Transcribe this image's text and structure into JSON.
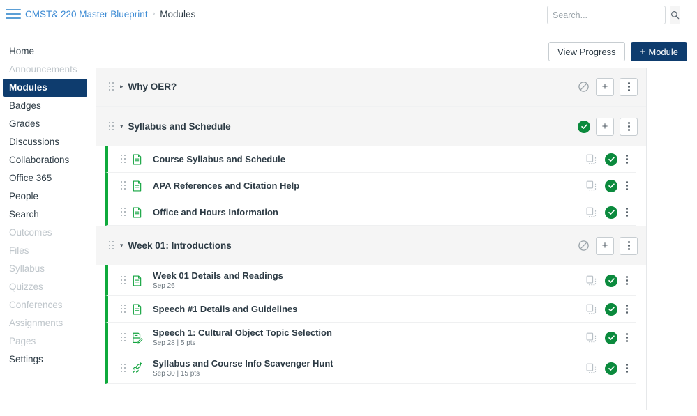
{
  "topbar": {
    "menu_icon": "hamburger-icon",
    "breadcrumb": {
      "course": "CMST& 220 Master Blueprint",
      "separator": "›",
      "current": "Modules"
    },
    "search": {
      "placeholder": "Search...",
      "value": "",
      "button_icon": "search-icon"
    }
  },
  "sidebar": {
    "items": [
      {
        "label": "Home",
        "state": "normal"
      },
      {
        "label": "Announcements",
        "state": "dim"
      },
      {
        "label": "Modules",
        "state": "active"
      },
      {
        "label": "Badges",
        "state": "normal"
      },
      {
        "label": "Grades",
        "state": "normal"
      },
      {
        "label": "Discussions",
        "state": "normal"
      },
      {
        "label": "Collaborations",
        "state": "normal"
      },
      {
        "label": "Office 365",
        "state": "normal"
      },
      {
        "label": "People",
        "state": "normal"
      },
      {
        "label": "Search",
        "state": "normal"
      },
      {
        "label": "Outcomes",
        "state": "dim"
      },
      {
        "label": "Files",
        "state": "dim"
      },
      {
        "label": "Syllabus",
        "state": "dim"
      },
      {
        "label": "Quizzes",
        "state": "dim"
      },
      {
        "label": "Conferences",
        "state": "dim"
      },
      {
        "label": "Assignments",
        "state": "dim"
      },
      {
        "label": "Pages",
        "state": "dim"
      },
      {
        "label": "Settings",
        "state": "normal"
      }
    ]
  },
  "toolbar": {
    "view_progress_label": "View Progress",
    "add_module_plus": "+",
    "add_module_label": "Module"
  },
  "colors": {
    "brand_navy": "#0e3c6e",
    "link_blue": "#3d8bd4",
    "published_green": "#0b8a3d",
    "item_rail_green": "#0faa3c",
    "header_gray": "#f5f5f5"
  },
  "modules": [
    {
      "title": "Why OER?",
      "expanded": false,
      "twisty": "▸",
      "status": "unpublished",
      "status_icon": "circle-slash-icon",
      "add_label": "+",
      "menu_icon": "kebab-menu-icon",
      "items": []
    },
    {
      "title": "Syllabus and Schedule",
      "expanded": true,
      "twisty": "▾",
      "status": "published",
      "status_icon": "check-circle-icon",
      "add_label": "+",
      "menu_icon": "kebab-menu-icon",
      "items": [
        {
          "title": "Course Syllabus and Schedule",
          "subtitle": "",
          "type_icon": "page-icon",
          "status": "published",
          "copy_icon": "duplicate-icon",
          "menu_icon": "kebab-menu-icon"
        },
        {
          "title": "APA References and Citation Help",
          "subtitle": "",
          "type_icon": "page-icon",
          "status": "published",
          "copy_icon": "duplicate-icon",
          "menu_icon": "kebab-menu-icon"
        },
        {
          "title": "Office and Hours Information",
          "subtitle": "",
          "type_icon": "page-icon",
          "status": "published",
          "copy_icon": "duplicate-icon",
          "menu_icon": "kebab-menu-icon"
        }
      ]
    },
    {
      "title": "Week 01: Introductions",
      "expanded": true,
      "twisty": "▾",
      "status": "unpublished",
      "status_icon": "circle-slash-icon",
      "add_label": "+",
      "menu_icon": "kebab-menu-icon",
      "items": [
        {
          "title": "Week 01 Details and Readings",
          "subtitle": "Sep 26",
          "type_icon": "page-icon",
          "status": "published",
          "copy_icon": "duplicate-icon",
          "menu_icon": "kebab-menu-icon"
        },
        {
          "title": "Speech #1 Details and Guidelines",
          "subtitle": "",
          "type_icon": "page-icon",
          "status": "published",
          "copy_icon": "duplicate-icon",
          "menu_icon": "kebab-menu-icon"
        },
        {
          "title": "Speech 1: Cultural Object Topic Selection",
          "subtitle": "Sep 28  |  5 pts",
          "type_icon": "assignment-icon",
          "status": "published",
          "copy_icon": "duplicate-icon",
          "menu_icon": "kebab-menu-icon"
        },
        {
          "title": "Syllabus and Course Info Scavenger Hunt",
          "subtitle": "Sep 30  |  15 pts",
          "type_icon": "rocket-quiz-icon",
          "status": "published",
          "copy_icon": "duplicate-icon",
          "menu_icon": "kebab-menu-icon"
        }
      ]
    }
  ]
}
